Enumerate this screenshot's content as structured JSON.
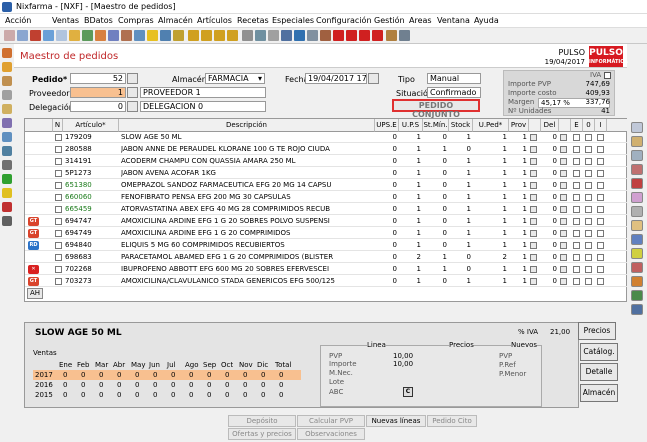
{
  "window": {
    "title": "Nixfarma - [NXF] - [Maestro de pedidos]"
  },
  "menu": [
    "Acción",
    "Ventas",
    "BDatos",
    "Compras",
    "Almacén",
    "Artículos",
    "Recetas",
    "Especiales",
    "Configuración",
    "Gestión",
    "Areas",
    "Ventana",
    "Ayuda"
  ],
  "header": {
    "title": "Maestro de pedidos",
    "store": "PULSO",
    "date": "19/04/2017",
    "logo": "PULSO",
    "logo_sub": "INFORMÁTICA"
  },
  "form": {
    "pedido_label": "Pedido*",
    "pedido_value": "52",
    "proveedor_label": "Proveedor",
    "proveedor_code": "1",
    "proveedor_name": "PROVEEDOR 1",
    "delegacion_label": "Delegación",
    "delegacion_code": "0",
    "delegacion_name": "DELEGACION 0",
    "almacen_label": "Almacén*",
    "almacen_value": "FARMACIA",
    "fecha_label": "Fecha",
    "fecha_value": "19/04/2017 17:05",
    "tipo_label": "Tipo",
    "tipo_value": "Manual",
    "situacion_label": "Situación",
    "situacion_value": "Confirmado",
    "conjunto": "PEDIDO CONJUNTO"
  },
  "stats": {
    "iva_label": "IVA",
    "items": [
      {
        "label": "Importe PVP",
        "value": "747,69"
      },
      {
        "label": "Importe costo",
        "value": "409,93"
      },
      {
        "label": "Margen",
        "pct": "45,17 %",
        "value": "337,76"
      },
      {
        "label": "Nº Unidades",
        "value": "41"
      }
    ]
  },
  "grid": {
    "columns": [
      "N",
      "Artículo*",
      "Descripción",
      "UPS.E",
      "U.P.S",
      "St.Mín.",
      "Stock",
      "U.Ped*",
      "Prov",
      "Del",
      "E",
      "0",
      "I"
    ],
    "rows": [
      {
        "code": "179209",
        "desc": "SLOW AGE 50 ML",
        "ups_e": "0",
        "ups": "1",
        "stmin": "0",
        "stock": "1",
        "uped": "1",
        "prov": "1",
        "del": "0",
        "color": "#000",
        "badge": "",
        "badgecolor": ""
      },
      {
        "code": "280588",
        "desc": "JABON ANNE DE PERAUDEL KLORANE 100 G TE ROJO CIUDA",
        "ups_e": "0",
        "ups": "1",
        "stmin": "1",
        "stock": "0",
        "uped": "1",
        "prov": "1",
        "del": "0",
        "color": "#000",
        "badge": "",
        "badgecolor": ""
      },
      {
        "code": "314191",
        "desc": "ACODERM CHAMPU CON QUASSIA AMARA 250 ML",
        "ups_e": "0",
        "ups": "1",
        "stmin": "0",
        "stock": "1",
        "uped": "1",
        "prov": "1",
        "del": "0",
        "color": "#000",
        "badge": "",
        "badgecolor": ""
      },
      {
        "code": "5P1273",
        "desc": "JABON AVENA          ACOFAR  1KG",
        "ups_e": "0",
        "ups": "1",
        "stmin": "0",
        "stock": "1",
        "uped": "1",
        "prov": "1",
        "del": "0",
        "color": "#000",
        "badge": "",
        "badgecolor": ""
      },
      {
        "code": "651380",
        "desc": "OMEPRAZOL SANDOZ FARMACEUTICA EFG 20 MG 14 CAPSU",
        "ups_e": "0",
        "ups": "1",
        "stmin": "0",
        "stock": "1",
        "uped": "1",
        "prov": "1",
        "del": "0",
        "color": "#1a7a1a",
        "badge": "",
        "badgecolor": ""
      },
      {
        "code": "660060",
        "desc": "FENOFIBRATO PENSA EFG 200 MG 30 CAPSULAS",
        "ups_e": "0",
        "ups": "1",
        "stmin": "0",
        "stock": "1",
        "uped": "1",
        "prov": "1",
        "del": "0",
        "color": "#1a7a1a",
        "badge": "",
        "badgecolor": ""
      },
      {
        "code": "665459",
        "desc": "ATORVASTATINA ABEX EFG 40 MG 28 COMPRIMIDOS RECUB",
        "ups_e": "0",
        "ups": "1",
        "stmin": "0",
        "stock": "1",
        "uped": "1",
        "prov": "1",
        "del": "0",
        "color": "#1a7a1a",
        "badge": "",
        "badgecolor": ""
      },
      {
        "code": "694747",
        "desc": "AMOXICILINA ARDINE EFG 1 G 20 SOBRES POLVO SUSPENSI",
        "ups_e": "0",
        "ups": "1",
        "stmin": "0",
        "stock": "1",
        "uped": "1",
        "prov": "1",
        "del": "0",
        "color": "#000",
        "badge": "GT",
        "badgecolor": "#d9442c"
      },
      {
        "code": "694749",
        "desc": "AMOXICILINA ARDINE EFG 1 G 20 COMPRIMIDOS",
        "ups_e": "0",
        "ups": "1",
        "stmin": "0",
        "stock": "1",
        "uped": "1",
        "prov": "1",
        "del": "0",
        "color": "#000",
        "badge": "GT",
        "badgecolor": "#d9442c"
      },
      {
        "code": "694840",
        "desc": "ELIQUIS 5 MG 60 COMPRIMIDOS RECUBIERTOS",
        "ups_e": "0",
        "ups": "1",
        "stmin": "0",
        "stock": "1",
        "uped": "1",
        "prov": "1",
        "del": "0",
        "color": "#000",
        "badge": "RD",
        "badgecolor": "#2a72c8"
      },
      {
        "code": "698683",
        "desc": "PARACETAMOL ABAMED EFG 1 G 20 COMPRIMIDOS (BLISTER",
        "ups_e": "0",
        "ups": "2",
        "stmin": "1",
        "stock": "0",
        "uped": "2",
        "prov": "1",
        "del": "0",
        "color": "#000",
        "badge": "",
        "badgecolor": ""
      },
      {
        "code": "702268",
        "desc": "IBUPROFENO ABBOTT EFG 600 MG 20 SOBRES EFERVESCEI",
        "ups_e": "0",
        "ups": "1",
        "stmin": "1",
        "stock": "0",
        "uped": "1",
        "prov": "1",
        "del": "0",
        "color": "#000",
        "badge": "✕",
        "badgecolor": "#d92020"
      },
      {
        "code": "703273",
        "desc": "AMOXICILINA/CLAVULANICO STADA GENERICOS EFG 500/125",
        "ups_e": "0",
        "ups": "1",
        "stmin": "0",
        "stock": "1",
        "uped": "1",
        "prov": "1",
        "del": "0",
        "color": "#000",
        "badge": "GT",
        "badgecolor": "#d9442c"
      }
    ],
    "footer_btn": "AH"
  },
  "detail": {
    "title": "SLOW AGE  50 ML",
    "iva_label": "% IVA",
    "iva_value": "21,00",
    "ventas_label": "Ventas",
    "months": [
      "Ene",
      "Feb",
      "Mar",
      "Abr",
      "May",
      "Jun",
      "Jul",
      "Ago",
      "Sep",
      "Oct",
      "Nov",
      "Dic",
      "Total"
    ],
    "years": [
      {
        "year": "2017",
        "values": [
          "0",
          "0",
          "0",
          "0",
          "0",
          "0",
          "0",
          "0",
          "0",
          "0",
          "0",
          "0",
          "0"
        ]
      },
      {
        "year": "2016",
        "values": [
          "0",
          "0",
          "0",
          "0",
          "0",
          "0",
          "0",
          "0",
          "0",
          "0",
          "0",
          "0",
          "0"
        ]
      },
      {
        "year": "2015",
        "values": [
          "0",
          "0",
          "0",
          "0",
          "0",
          "0",
          "0",
          "0",
          "0",
          "0",
          "0",
          "0",
          "0"
        ]
      }
    ],
    "linea_label": "Linea",
    "precios_label": "Precios",
    "nuevos_label": "Nuevos",
    "linea": [
      {
        "label": "PVP",
        "value": "10,00"
      },
      {
        "label": "Importe",
        "value": "10,00"
      },
      {
        "label": "M.Nec.",
        "value": ""
      },
      {
        "label": "Lote",
        "value": ""
      },
      {
        "label": "ABC",
        "value": "C"
      }
    ],
    "nuevos": [
      "PVP",
      "P.Ref",
      "P.Menor"
    ]
  },
  "side_buttons": [
    "Precios",
    "Catálog.",
    "Detalle",
    "Almacén"
  ],
  "bottom_buttons": [
    "Depósito",
    "Calcular PVP",
    "Nuevas líneas",
    "Pedido Cito",
    "Ofertas y precios",
    "Observaciones"
  ]
}
